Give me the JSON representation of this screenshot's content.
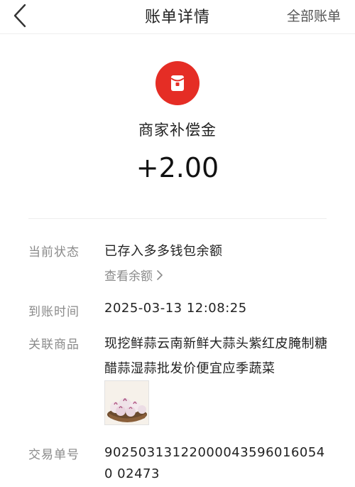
{
  "header": {
    "title": "账单详情",
    "right_link": "全部账单"
  },
  "hero": {
    "icon": "red-packet-icon",
    "title": "商家补偿金",
    "amount": "+2.00"
  },
  "details": {
    "status": {
      "label": "当前状态",
      "value": "已存入多多钱包余额",
      "link": "查看余额"
    },
    "arrival_time": {
      "label": "到账时间",
      "value": "2025-03-13 12:08:25"
    },
    "product": {
      "label": "关联商品",
      "name": "现挖鲜蒜云南新鲜大蒜头紫红皮腌制糖醋蒜湿蒜批发价便宜应季蔬菜"
    },
    "order": {
      "label": "交易单号",
      "value": "902503131220000435960160540 02473"
    }
  },
  "colors": {
    "accent": "#e52d25",
    "label": "#8a8a8a",
    "text": "#222222"
  }
}
